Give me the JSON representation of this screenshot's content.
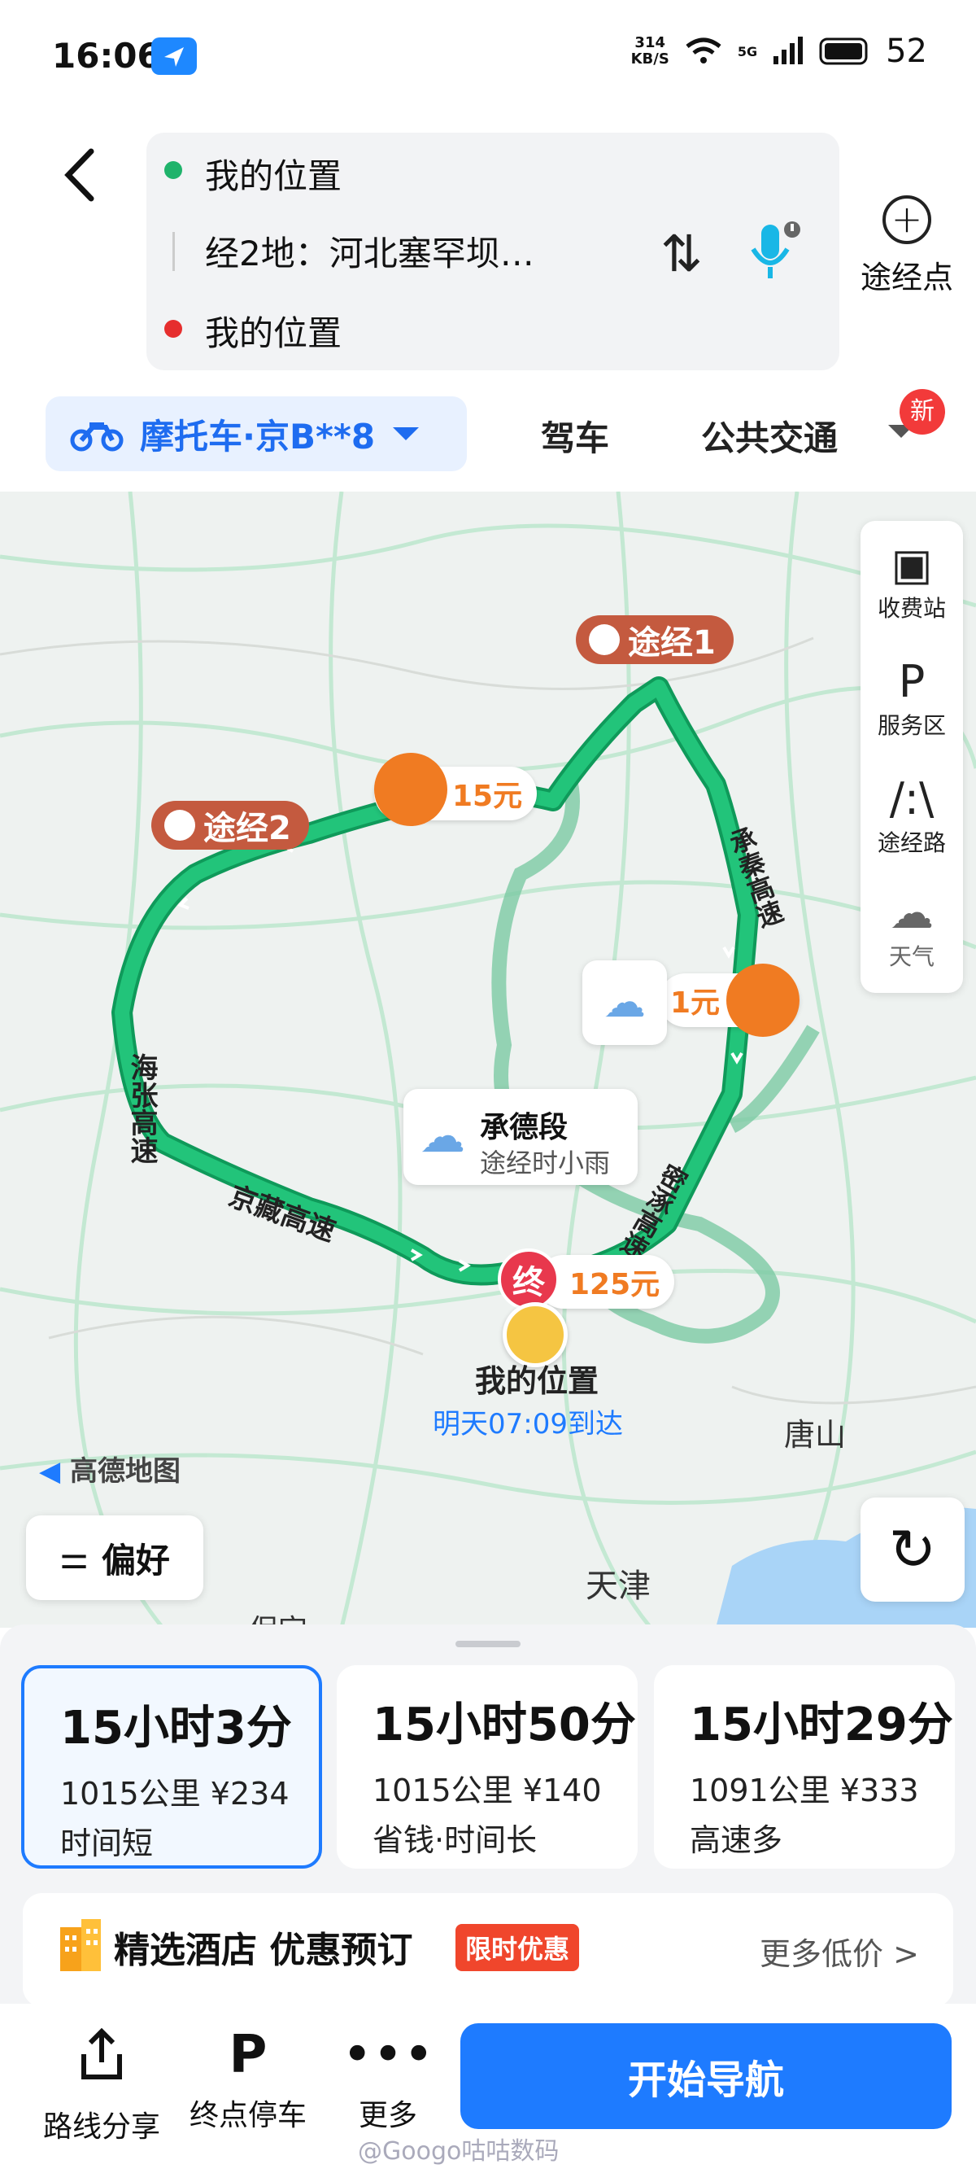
{
  "status_bar": {
    "time": "16:06",
    "net_speed_top": "314",
    "net_speed_bottom": "KB/S",
    "signal_label": "5G",
    "battery": "52"
  },
  "route_inputs": {
    "start": "我的位置",
    "waypoint": "经2地：河北塞罕坝…",
    "end": "我的位置",
    "add_waypoint_label": "途经点"
  },
  "modes": {
    "selected": "摩托车·京B**8",
    "tabs": [
      "驾车",
      "公共交通"
    ],
    "new_badge": "新"
  },
  "map": {
    "waypoint_1": "途经1",
    "waypoint_2": "途经2",
    "toll_1": "15元",
    "toll_2": "1元",
    "toll_3": "125元",
    "road_1": "海张高速",
    "road_2": "京藏高速",
    "road_3": "承秦高速",
    "road_4": "密涿高速",
    "weather_title": "承德段",
    "weather_desc": "途经时小雨",
    "end_marker": "终",
    "my_location": "我的位置",
    "arrival": "明天07:09到达",
    "city_1": "唐山",
    "city_2": "天津",
    "city_3": "保定",
    "logo": "高德地图",
    "side_panel": [
      "收费站",
      "服务区",
      "途经路",
      "天气"
    ],
    "preference": "偏好"
  },
  "routes": [
    {
      "time": "15小时3分",
      "info": "1015公里 ¥234",
      "tag": "时间短"
    },
    {
      "time": "15小时50分",
      "info": "1015公里 ¥140",
      "tag": "省钱·时间长"
    },
    {
      "time": "15小时29分",
      "info": "1091公里 ¥333",
      "tag": "高速多"
    }
  ],
  "hotel": {
    "title": "精选酒店 优惠预订",
    "badge": "限时优惠",
    "more": "更多低价 >"
  },
  "bottom": {
    "share": "路线分享",
    "parking": "终点停车",
    "more": "更多",
    "navigate": "开始导航",
    "watermark": "@Googo咕咕数码"
  },
  "colors": {
    "primary": "#1e7bff",
    "route": "#1fb36b",
    "toll": "#f07b22",
    "waypoint": "#c45a3f"
  }
}
